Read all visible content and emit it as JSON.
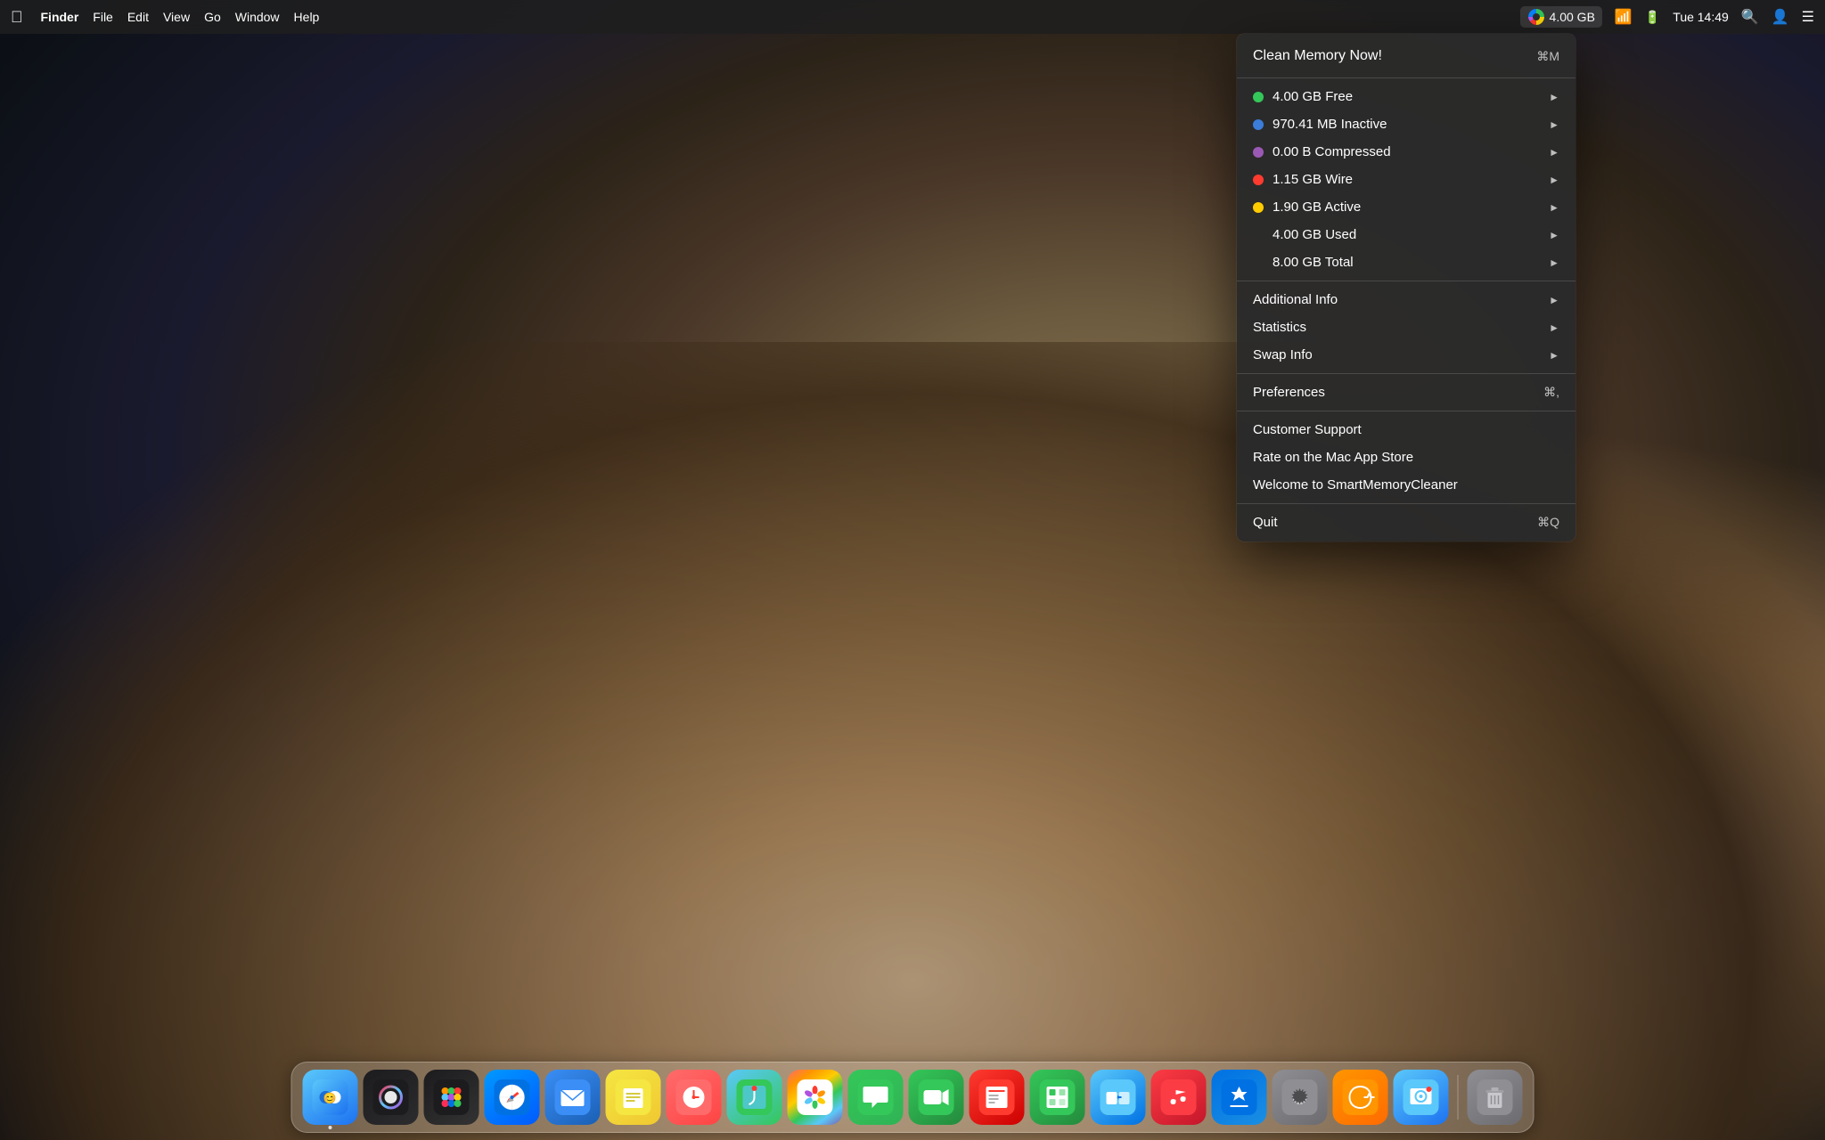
{
  "menubar": {
    "apple_label": "",
    "items": [
      "Finder",
      "File",
      "Edit",
      "View",
      "Go",
      "Window",
      "Help"
    ],
    "right": {
      "memory_label": "4.00 GB",
      "time_label": "Tue 14:49"
    }
  },
  "dropdown": {
    "clean_memory_label": "Clean Memory Now!",
    "clean_memory_shortcut": "⌘M",
    "memory_items": [
      {
        "label": "4.00 GB Free",
        "color": "green",
        "has_arrow": true
      },
      {
        "label": "970.41 MB Inactive",
        "color": "blue",
        "has_arrow": true
      },
      {
        "label": "0.00 B Compressed",
        "color": "purple",
        "has_arrow": true
      },
      {
        "label": "1.15 GB Wire",
        "color": "red",
        "has_arrow": true
      },
      {
        "label": "1.90 GB Active",
        "color": "yellow",
        "has_arrow": true
      },
      {
        "label": "4.00 GB Used",
        "color": "none",
        "has_arrow": true
      },
      {
        "label": "8.00 GB Total",
        "color": "none",
        "has_arrow": true
      }
    ],
    "submenu_items": [
      {
        "label": "Additional Info",
        "has_arrow": true
      },
      {
        "label": "Statistics",
        "has_arrow": true
      },
      {
        "label": "Swap Info",
        "has_arrow": true
      }
    ],
    "preferences_label": "Preferences",
    "preferences_shortcut": "⌘,",
    "support_items": [
      {
        "label": "Customer Support"
      },
      {
        "label": "Rate on the Mac App Store"
      },
      {
        "label": "Welcome to SmartMemoryCleaner"
      }
    ],
    "quit_label": "Quit",
    "quit_shortcut": "⌘Q"
  },
  "dock": {
    "icons": [
      {
        "name": "Finder",
        "emoji": "🔵",
        "type": "finder",
        "dot": true
      },
      {
        "name": "Siri",
        "emoji": "🎤",
        "type": "siri",
        "dot": false
      },
      {
        "name": "Launchpad",
        "emoji": "🚀",
        "type": "launchpad",
        "dot": false
      },
      {
        "name": "Safari",
        "emoji": "🧭",
        "type": "safari",
        "dot": false
      },
      {
        "name": "Mail",
        "emoji": "✉️",
        "type": "mail",
        "dot": false
      },
      {
        "name": "Notes",
        "emoji": "📝",
        "type": "notes",
        "dot": false
      },
      {
        "name": "Reminders",
        "emoji": "📋",
        "type": "reminders",
        "dot": false
      },
      {
        "name": "Maps",
        "emoji": "🗺️",
        "type": "maps",
        "dot": false
      },
      {
        "name": "Photos",
        "emoji": "🌸",
        "type": "photos",
        "dot": false
      },
      {
        "name": "Messages",
        "emoji": "💬",
        "type": "messages",
        "dot": false
      },
      {
        "name": "FaceTime",
        "emoji": "📹",
        "type": "facetime",
        "dot": false
      },
      {
        "name": "News",
        "emoji": "📰",
        "type": "news",
        "dot": false
      },
      {
        "name": "Numbers",
        "emoji": "📊",
        "type": "numbers",
        "dot": false
      },
      {
        "name": "MigrationAssistant",
        "emoji": "🔄",
        "type": "migrationassist",
        "dot": false
      },
      {
        "name": "Music",
        "emoji": "🎵",
        "type": "itunes",
        "dot": false
      },
      {
        "name": "App Store",
        "emoji": "🅐",
        "type": "appstore",
        "dot": false
      },
      {
        "name": "System Preferences",
        "emoji": "⚙️",
        "type": "prefs",
        "dot": false
      },
      {
        "name": "Lasso",
        "emoji": "🌀",
        "type": "lasso",
        "dot": false
      },
      {
        "name": "Screenshot",
        "emoji": "📷",
        "type": "screenshot",
        "dot": false
      },
      {
        "name": "Trash",
        "emoji": "🗑️",
        "type": "trash",
        "dot": false
      }
    ]
  }
}
